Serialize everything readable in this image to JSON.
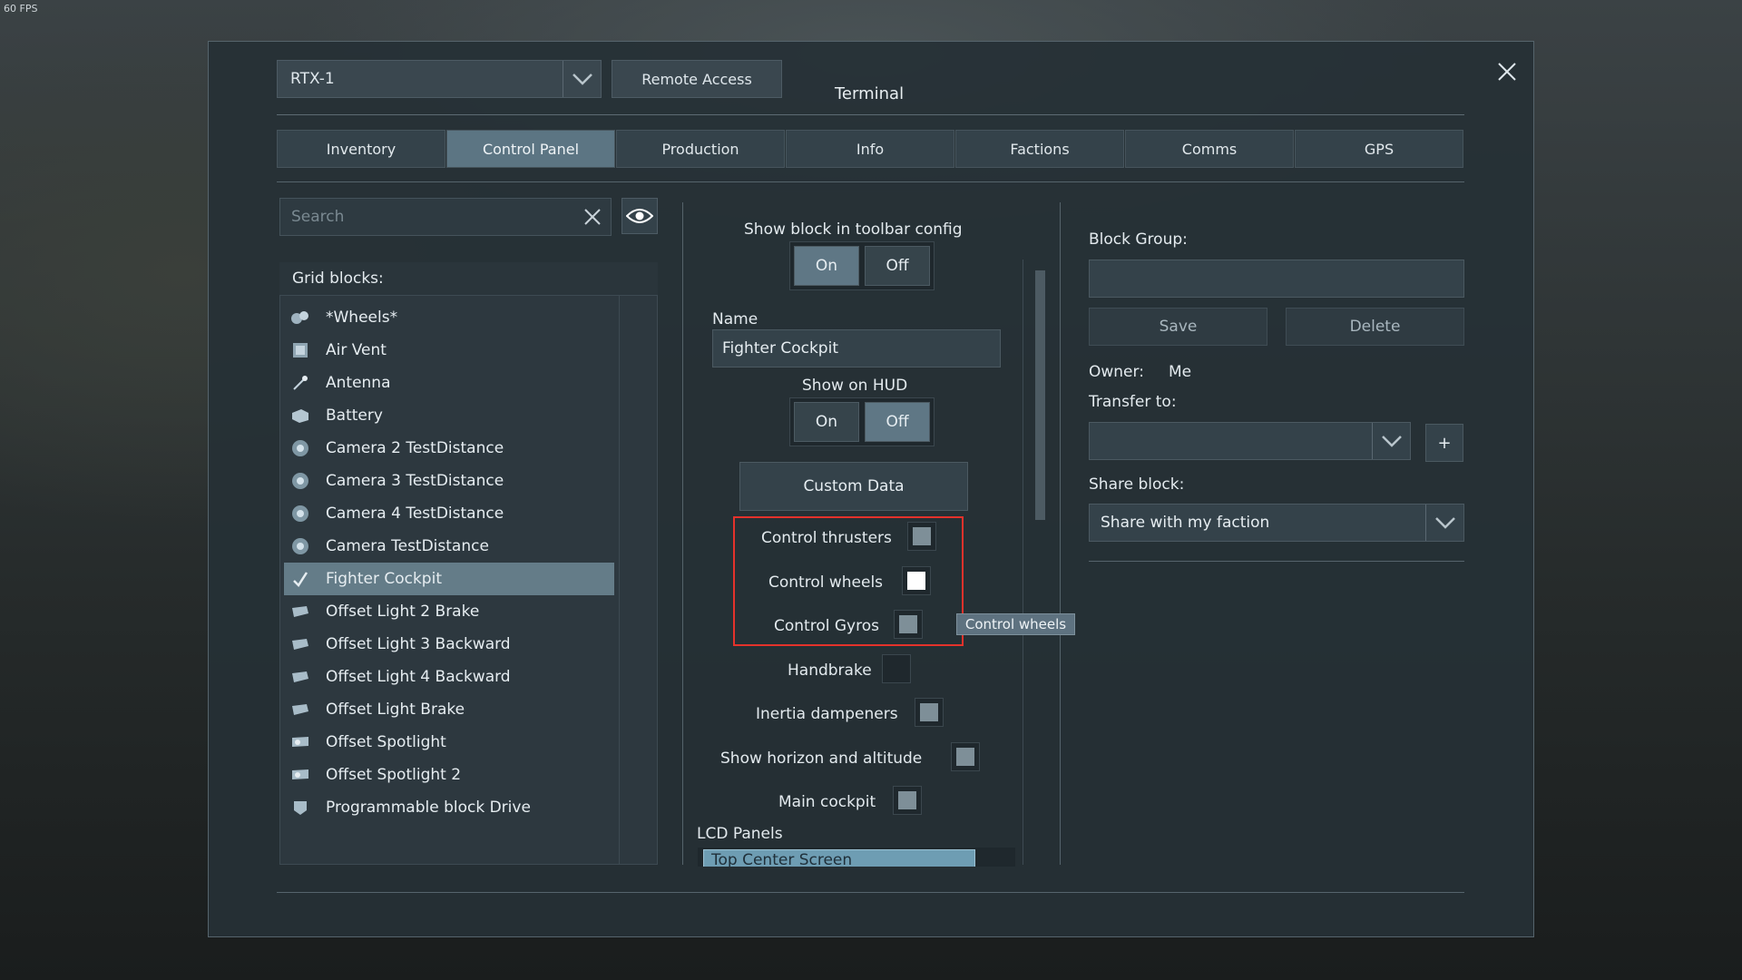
{
  "fps": "60 FPS",
  "header": {
    "grid_name": "RTX-1",
    "remote_access": "Remote Access",
    "title": "Terminal"
  },
  "tabs": [
    {
      "label": "Inventory"
    },
    {
      "label": "Control Panel"
    },
    {
      "label": "Production"
    },
    {
      "label": "Info"
    },
    {
      "label": "Factions"
    },
    {
      "label": "Comms"
    },
    {
      "label": "GPS"
    }
  ],
  "active_tab": "Control Panel",
  "search": {
    "placeholder": "Search",
    "value": ""
  },
  "grid_blocks": {
    "header": "Grid blocks:",
    "items": [
      {
        "label": "*Wheels*",
        "icon": "wheels-group-icon"
      },
      {
        "label": "Air Vent",
        "icon": "air-vent-icon"
      },
      {
        "label": "Antenna",
        "icon": "antenna-icon"
      },
      {
        "label": "Battery",
        "icon": "battery-icon"
      },
      {
        "label": "Camera 2 TestDistance",
        "icon": "camera-icon"
      },
      {
        "label": "Camera 3 TestDistance",
        "icon": "camera-icon"
      },
      {
        "label": "Camera 4 TestDistance",
        "icon": "camera-icon"
      },
      {
        "label": "Camera TestDistance",
        "icon": "camera-icon"
      },
      {
        "label": "Fighter Cockpit",
        "icon": "cockpit-icon"
      },
      {
        "label": "Offset Light 2 Brake",
        "icon": "light-icon"
      },
      {
        "label": "Offset Light 3 Backward",
        "icon": "light-icon"
      },
      {
        "label": "Offset Light 4 Backward",
        "icon": "light-icon"
      },
      {
        "label": "Offset Light Brake",
        "icon": "light-icon"
      },
      {
        "label": "Offset Spotlight",
        "icon": "spotlight-icon"
      },
      {
        "label": "Offset Spotlight 2",
        "icon": "spotlight-icon"
      },
      {
        "label": "Programmable block Drive",
        "icon": "programmable-block-icon"
      }
    ],
    "selected": "Fighter Cockpit"
  },
  "block_settings": {
    "toolbar_label": "Show block in toolbar config",
    "toolbar_on": "On",
    "toolbar_off": "Off",
    "toolbar_value": "On",
    "name_label": "Name",
    "name_value": "Fighter Cockpit",
    "hud_label": "Show on HUD",
    "hud_on": "On",
    "hud_off": "Off",
    "hud_value": "Off",
    "custom_data": "Custom Data",
    "checks": [
      {
        "label": "Control thrusters",
        "state": "unchecked"
      },
      {
        "label": "Control wheels",
        "state": "checked"
      },
      {
        "label": "Control Gyros",
        "state": "unchecked"
      },
      {
        "label": "Handbrake",
        "state": "empty"
      },
      {
        "label": "Inertia dampeners",
        "state": "unchecked"
      },
      {
        "label": "Show horizon and altitude",
        "state": "unchecked"
      },
      {
        "label": "Main cockpit",
        "state": "unchecked"
      }
    ],
    "tooltip": "Control wheels",
    "lcd_label": "LCD Panels",
    "lcd_items": [
      "Top Center Screen"
    ]
  },
  "right_panel": {
    "block_group_label": "Block Group:",
    "block_group_value": "",
    "save": "Save",
    "delete": "Delete",
    "owner_label": "Owner:",
    "owner_value": "Me",
    "transfer_label": "Transfer to:",
    "transfer_value": "",
    "plus": "+",
    "share_label": "Share block:",
    "share_value": "Share with my faction"
  },
  "colors": {
    "accent": "#5c7583",
    "highlight": "#e4322b",
    "selected_row": "#647c88"
  }
}
